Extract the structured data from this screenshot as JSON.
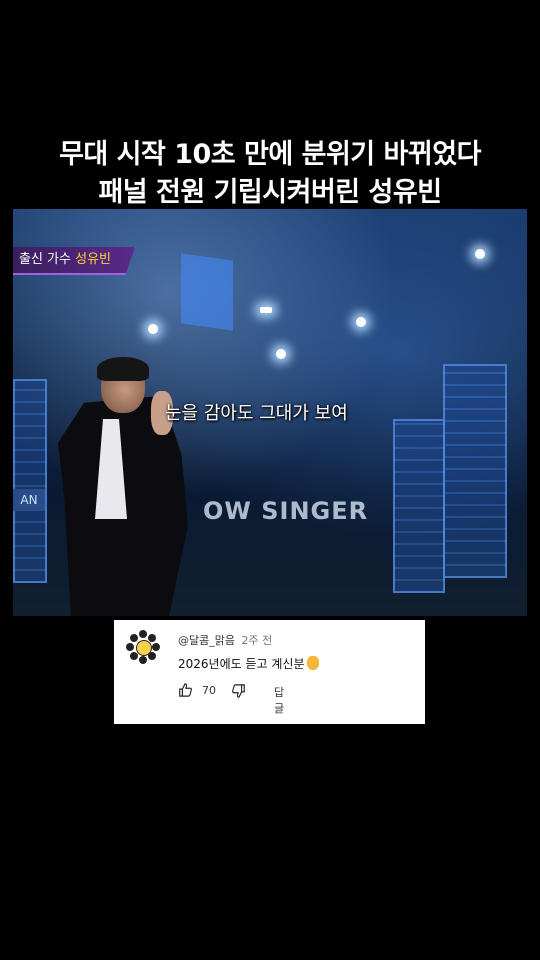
{
  "headline": {
    "line1": "무대 시작 10초 만에 분위기 바뀌었다",
    "line2": "패널 전원 기립시켜버린 성유빈"
  },
  "video": {
    "caption_prefix": "출신 가수",
    "caption_name": "성유빈",
    "subtitle": "눈을 감아도 그대가 보여",
    "stage_banner": "OW SINGER",
    "stage_side_text": "AN"
  },
  "comment": {
    "author": "@달콤_맑음",
    "time": "2주 전",
    "text": "2026년에도 듣고 계신분",
    "likes": "70",
    "reply_label": "답글"
  },
  "icons": {
    "like": "thumbs-up-icon",
    "dislike": "thumbs-down-icon",
    "avatar": "flower-avatar-icon",
    "emoji": "raised-hand-emoji"
  }
}
